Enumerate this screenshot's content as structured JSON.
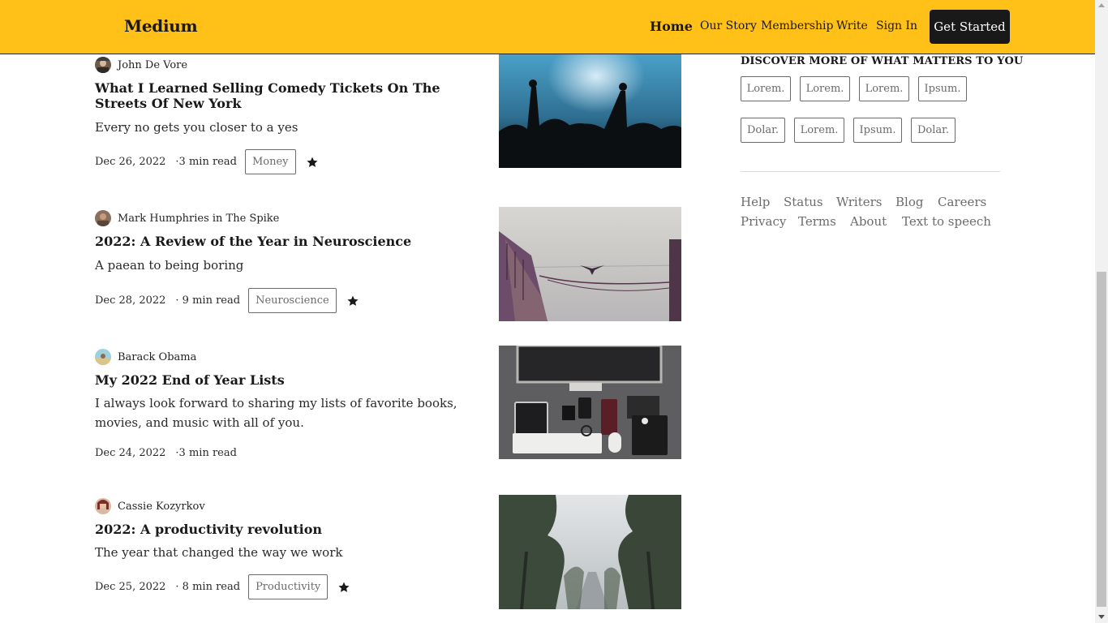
{
  "header": {
    "logo": "Medium",
    "nav": [
      "Home",
      "Our Story",
      "Membership",
      "Write",
      "Sign In"
    ],
    "cta": "Get Started",
    "brand_color": "#ffc017"
  },
  "articles": [
    {
      "author": "John De Vore",
      "title": "What I Learned Selling Comedy Tickets On The Streets Of New York",
      "subtitle": "Every no gets you closer to a yes",
      "date": "Dec 26, 2022",
      "read_time": "·3 min read",
      "tag": "Money",
      "starred": true,
      "image": "concert-crowd-photo"
    },
    {
      "author": "Mark Humphries in The Spike",
      "title": "2022: A Review of the Year in Neuroscience",
      "subtitle": "A paean to being boring",
      "date": "Dec 28, 2022",
      "read_time": "· 9 min read",
      "tag": "Neuroscience",
      "starred": true,
      "image": "boat-sea-photo"
    },
    {
      "author": "Barack Obama",
      "title": "My 2022 End of Year Lists",
      "subtitle": "I always look forward to sharing my lists of favorite books, movies, and music with all of you.",
      "date": "Dec 24, 2022",
      "read_time": "·3 min read",
      "tag": "",
      "starred": false,
      "image": "desk-setup-photo"
    },
    {
      "author": "Cassie Kozyrkov",
      "title": "2022: A productivity revolution",
      "subtitle": "The year that changed the way we work",
      "date": "Dec 25, 2022",
      "read_time": "· 8 min read",
      "tag": "Productivity",
      "starred": true,
      "image": "foggy-tree-road-photo"
    }
  ],
  "sidebar": {
    "discover_title": "DISCOVER MORE OF WHAT MATTERS TO YOU",
    "topics": [
      "Lorem.",
      "Lorem.",
      "Lorem.",
      "Ipsum.",
      "Dolar.",
      "Lorem.",
      "Ipsum.",
      "Dolar."
    ],
    "footer_links": [
      "Help",
      "Status",
      "Writers",
      "Blog",
      "Careers",
      "Privacy",
      "Terms",
      "About",
      "Text to speech"
    ]
  }
}
